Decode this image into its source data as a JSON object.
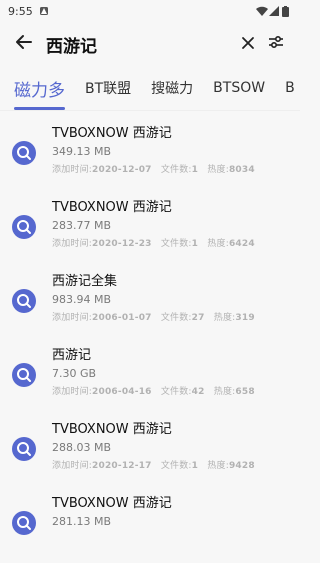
{
  "status": {
    "time": "9:55"
  },
  "search": {
    "query": "西游记"
  },
  "tabs": [
    {
      "label": "磁力多"
    },
    {
      "label": "BT联盟"
    },
    {
      "label": "搜磁力"
    },
    {
      "label": "BTSOW"
    },
    {
      "label": "B"
    }
  ],
  "results": [
    {
      "title": "TVBOXNOW 西游记",
      "size": "349.13 MB",
      "added_label": "添加时间:",
      "added": "2020-12-07",
      "files_label": "文件数:",
      "files": "1",
      "hot_label": "热度:",
      "hot": "8034"
    },
    {
      "title": "TVBOXNOW 西游记",
      "size": "283.77 MB",
      "added_label": "添加时间:",
      "added": "2020-12-23",
      "files_label": "文件数:",
      "files": "1",
      "hot_label": "热度:",
      "hot": "6424"
    },
    {
      "title": "西游记全集",
      "size": "983.94 MB",
      "added_label": "添加时间:",
      "added": "2006-01-07",
      "files_label": "文件数:",
      "files": "27",
      "hot_label": "热度:",
      "hot": "319"
    },
    {
      "title": "西游记",
      "size": "7.30 GB",
      "added_label": "添加时间:",
      "added": "2006-04-16",
      "files_label": "文件数:",
      "files": "42",
      "hot_label": "热度:",
      "hot": "658"
    },
    {
      "title": "TVBOXNOW 西游记",
      "size": "288.03 MB",
      "added_label": "添加时间:",
      "added": "2020-12-17",
      "files_label": "文件数:",
      "files": "1",
      "hot_label": "热度:",
      "hot": "9428"
    },
    {
      "title": "TVBOXNOW 西游记",
      "size": "281.13 MB",
      "added_label": "",
      "added": "",
      "files_label": "",
      "files": "",
      "hot_label": "",
      "hot": ""
    }
  ],
  "icons": {
    "back": "arrow-left-icon",
    "clear": "close-icon",
    "filter": "tune-icon",
    "result": "search-magnet-icon"
  },
  "colors": {
    "accent": "#5668cf",
    "muted": "#b2b2b2"
  }
}
